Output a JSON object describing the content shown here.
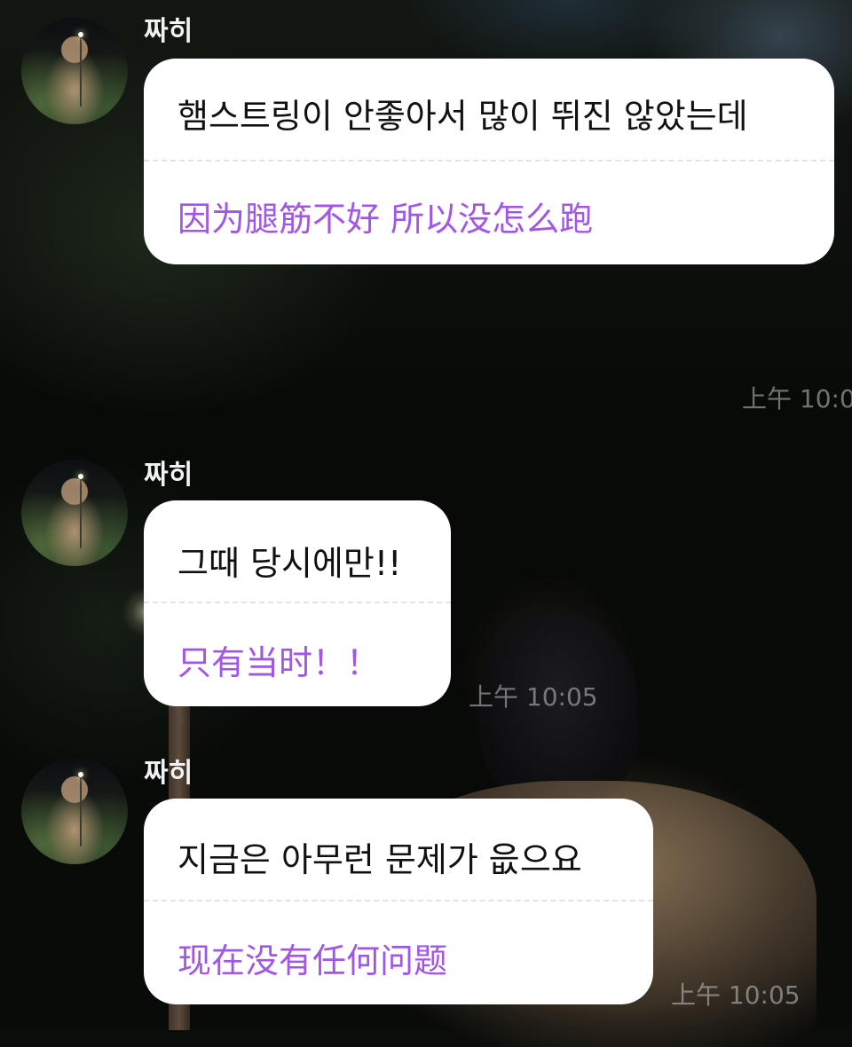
{
  "messages": [
    {
      "sender": "짜히",
      "korean": "햄스트링이 안좋아서 많이 뛰진 않았는데",
      "chinese": "因为腿筋不好 所以没怎么跑",
      "time": "上午 10:0"
    },
    {
      "sender": "짜히",
      "korean": "그때 당시에만!!",
      "chinese": "只有当时！！",
      "time": "上午 10:05"
    },
    {
      "sender": "짜히",
      "korean": "지금은 아무런 문제가 읎으요",
      "chinese": "现在没有任何问题",
      "time": "上午 10:05"
    }
  ],
  "colors": {
    "translation_text": "#a057e6",
    "bubble_bg": "#ffffff",
    "sender_text": "#f2f2f2"
  }
}
